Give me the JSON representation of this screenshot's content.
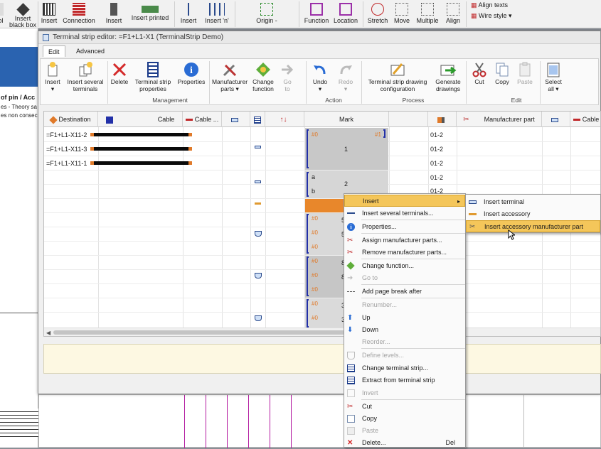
{
  "bg_toolbar": {
    "buttons": [
      {
        "label": "ol",
        "icon": "page-icon"
      },
      {
        "label": "Insert black box",
        "icon": "black-box-icon"
      },
      {
        "label": "Insert",
        "icon": "device-icon"
      },
      {
        "label": "Connection",
        "icon": "connection-icon"
      },
      {
        "label": "Insert",
        "icon": "plug-icon"
      },
      {
        "label": "Insert printed",
        "icon": "printed-icon"
      },
      {
        "label": "Insert",
        "icon": "terminal-icon"
      },
      {
        "label": "Insert 'n'",
        "icon": "terminals-icon"
      },
      {
        "label": "Origin -",
        "icon": "origin-icon"
      },
      {
        "label": "Function",
        "icon": "function-icon"
      },
      {
        "label": "Location",
        "icon": "location-icon"
      },
      {
        "label": "Stretch",
        "icon": "stretch-icon"
      },
      {
        "label": "Move",
        "icon": "move-icon"
      },
      {
        "label": "Multiple",
        "icon": "multiple-icon"
      },
      {
        "label": "Align",
        "icon": "align-icon"
      }
    ],
    "right_items": [
      "Align texts",
      "Wire style"
    ]
  },
  "bg_side": {
    "texts": [
      "of pin / Acc",
      "es - Theory sa",
      "es non consec"
    ]
  },
  "dialog": {
    "title": "Terminal strip editor: =F1+L1-X1 (TerminalStrip Demo)",
    "tabs": [
      "Edit",
      "Advanced"
    ],
    "ribbon": {
      "buttons": [
        {
          "label": "Insert",
          "sub": "▾",
          "icon": "insert-icon",
          "enabled": true
        },
        {
          "label": "Insert several",
          "sub": "terminals",
          "icon": "insert-several-icon",
          "enabled": true
        },
        {
          "label": "Delete",
          "sub": "",
          "icon": "delete-icon",
          "enabled": true
        },
        {
          "label": "Terminal strip",
          "sub": "properties",
          "icon": "strip-properties-icon",
          "enabled": true
        },
        {
          "label": "Properties",
          "sub": "",
          "icon": "properties-icon",
          "enabled": true
        },
        {
          "label": "Manufacturer",
          "sub": "parts ▾",
          "icon": "manufacturer-icon",
          "enabled": true
        },
        {
          "label": "Change",
          "sub": "function",
          "icon": "change-function-icon",
          "enabled": true
        },
        {
          "label": "Go",
          "sub": "to",
          "icon": "goto-icon",
          "enabled": false
        },
        {
          "label": "Undo",
          "sub": "▾",
          "icon": "undo-icon",
          "enabled": true
        },
        {
          "label": "Redo",
          "sub": "▾",
          "icon": "redo-icon",
          "enabled": false
        },
        {
          "label": "Terminal strip drawing",
          "sub": "configuration",
          "icon": "drawing-config-icon",
          "enabled": true
        },
        {
          "label": "Generate",
          "sub": "drawings",
          "icon": "generate-icon",
          "enabled": true
        },
        {
          "label": "Cut",
          "sub": "",
          "icon": "cut-icon",
          "enabled": true
        },
        {
          "label": "Copy",
          "sub": "",
          "icon": "copy-icon",
          "enabled": true
        },
        {
          "label": "Paste",
          "sub": "",
          "icon": "paste-icon",
          "enabled": false
        },
        {
          "label": "Select",
          "sub": "all ▾",
          "icon": "select-all-icon",
          "enabled": true
        }
      ],
      "groups": [
        "Management",
        "Action",
        "Process",
        "Edit"
      ]
    },
    "columns": [
      "Destination",
      "Cable",
      "Cable ...",
      "",
      "",
      "",
      "Mark",
      "",
      "",
      "Manufacturer part",
      "",
      "Cable"
    ],
    "rows": [
      {
        "destination": "=F1+L1-X11-2",
        "mark": "",
        "ref": "01-2"
      },
      {
        "destination": "=F1+L1-X11-3",
        "mark": "1",
        "ref": "01-2"
      },
      {
        "destination": "=F1+L1-X11-1",
        "mark": "",
        "ref": "01-2"
      },
      {
        "destination": "",
        "mark": "2",
        "ref": "01-2"
      },
      {
        "destination": "",
        "mark": "",
        "ref": "01-2"
      }
    ],
    "mark_labels": {
      "hash0": "#0",
      "hash1": "#1",
      "a": "a",
      "b": "b",
      "five": "5",
      "eight": "8",
      "three": "3"
    }
  },
  "context_menu": {
    "items": [
      {
        "label": "Insert",
        "icon": "insert-icon",
        "enabled": true,
        "submenu": true,
        "highlight": true
      },
      {
        "label": "Insert several terminals...",
        "icon": "terminal-icon",
        "enabled": true
      },
      {
        "label": "Properties...",
        "icon": "properties-icon",
        "enabled": true
      },
      {
        "label": "Assign manufacturer parts...",
        "icon": "manufacturer-icon",
        "enabled": true
      },
      {
        "label": "Remove manufacturer parts...",
        "icon": "remove-manufacturer-icon",
        "enabled": true
      },
      {
        "label": "Change function...",
        "icon": "change-function-icon",
        "enabled": true
      },
      {
        "label": "Go to",
        "icon": "goto-icon",
        "enabled": false
      },
      {
        "label": "Add page break after",
        "icon": "page-break-icon",
        "enabled": true
      },
      {
        "label": "Renumber...",
        "icon": "",
        "enabled": false
      },
      {
        "label": "Up",
        "icon": "up-arrow-icon",
        "enabled": true
      },
      {
        "label": "Down",
        "icon": "down-arrow-icon",
        "enabled": true
      },
      {
        "label": "Reorder...",
        "icon": "",
        "enabled": false
      },
      {
        "label": "Define levels...",
        "icon": "levels-icon",
        "enabled": false
      },
      {
        "label": "Change terminal strip...",
        "icon": "change-strip-icon",
        "enabled": true
      },
      {
        "label": "Extract from terminal strip",
        "icon": "extract-icon",
        "enabled": true
      },
      {
        "label": "Invert",
        "icon": "invert-icon",
        "enabled": false
      },
      {
        "label": "Cut",
        "icon": "cut-icon",
        "enabled": true
      },
      {
        "label": "Copy",
        "icon": "copy-icon",
        "enabled": true
      },
      {
        "label": "Paste",
        "icon": "paste-icon",
        "enabled": false
      },
      {
        "label": "Delete...",
        "icon": "delete-icon",
        "enabled": true,
        "shortcut": "Del"
      }
    ]
  },
  "submenu": {
    "items": [
      {
        "label": "Insert terminal",
        "icon": "terminal-icon"
      },
      {
        "label": "Insert accessory",
        "icon": "accessory-icon"
      },
      {
        "label": "Insert accessory manufacturer part",
        "icon": "accessory-part-icon",
        "highlight": true
      }
    ]
  },
  "colors": {
    "highlight": "#f4c65a",
    "accent_orange": "#e07a2a",
    "bracket_blue": "#2230a8"
  }
}
